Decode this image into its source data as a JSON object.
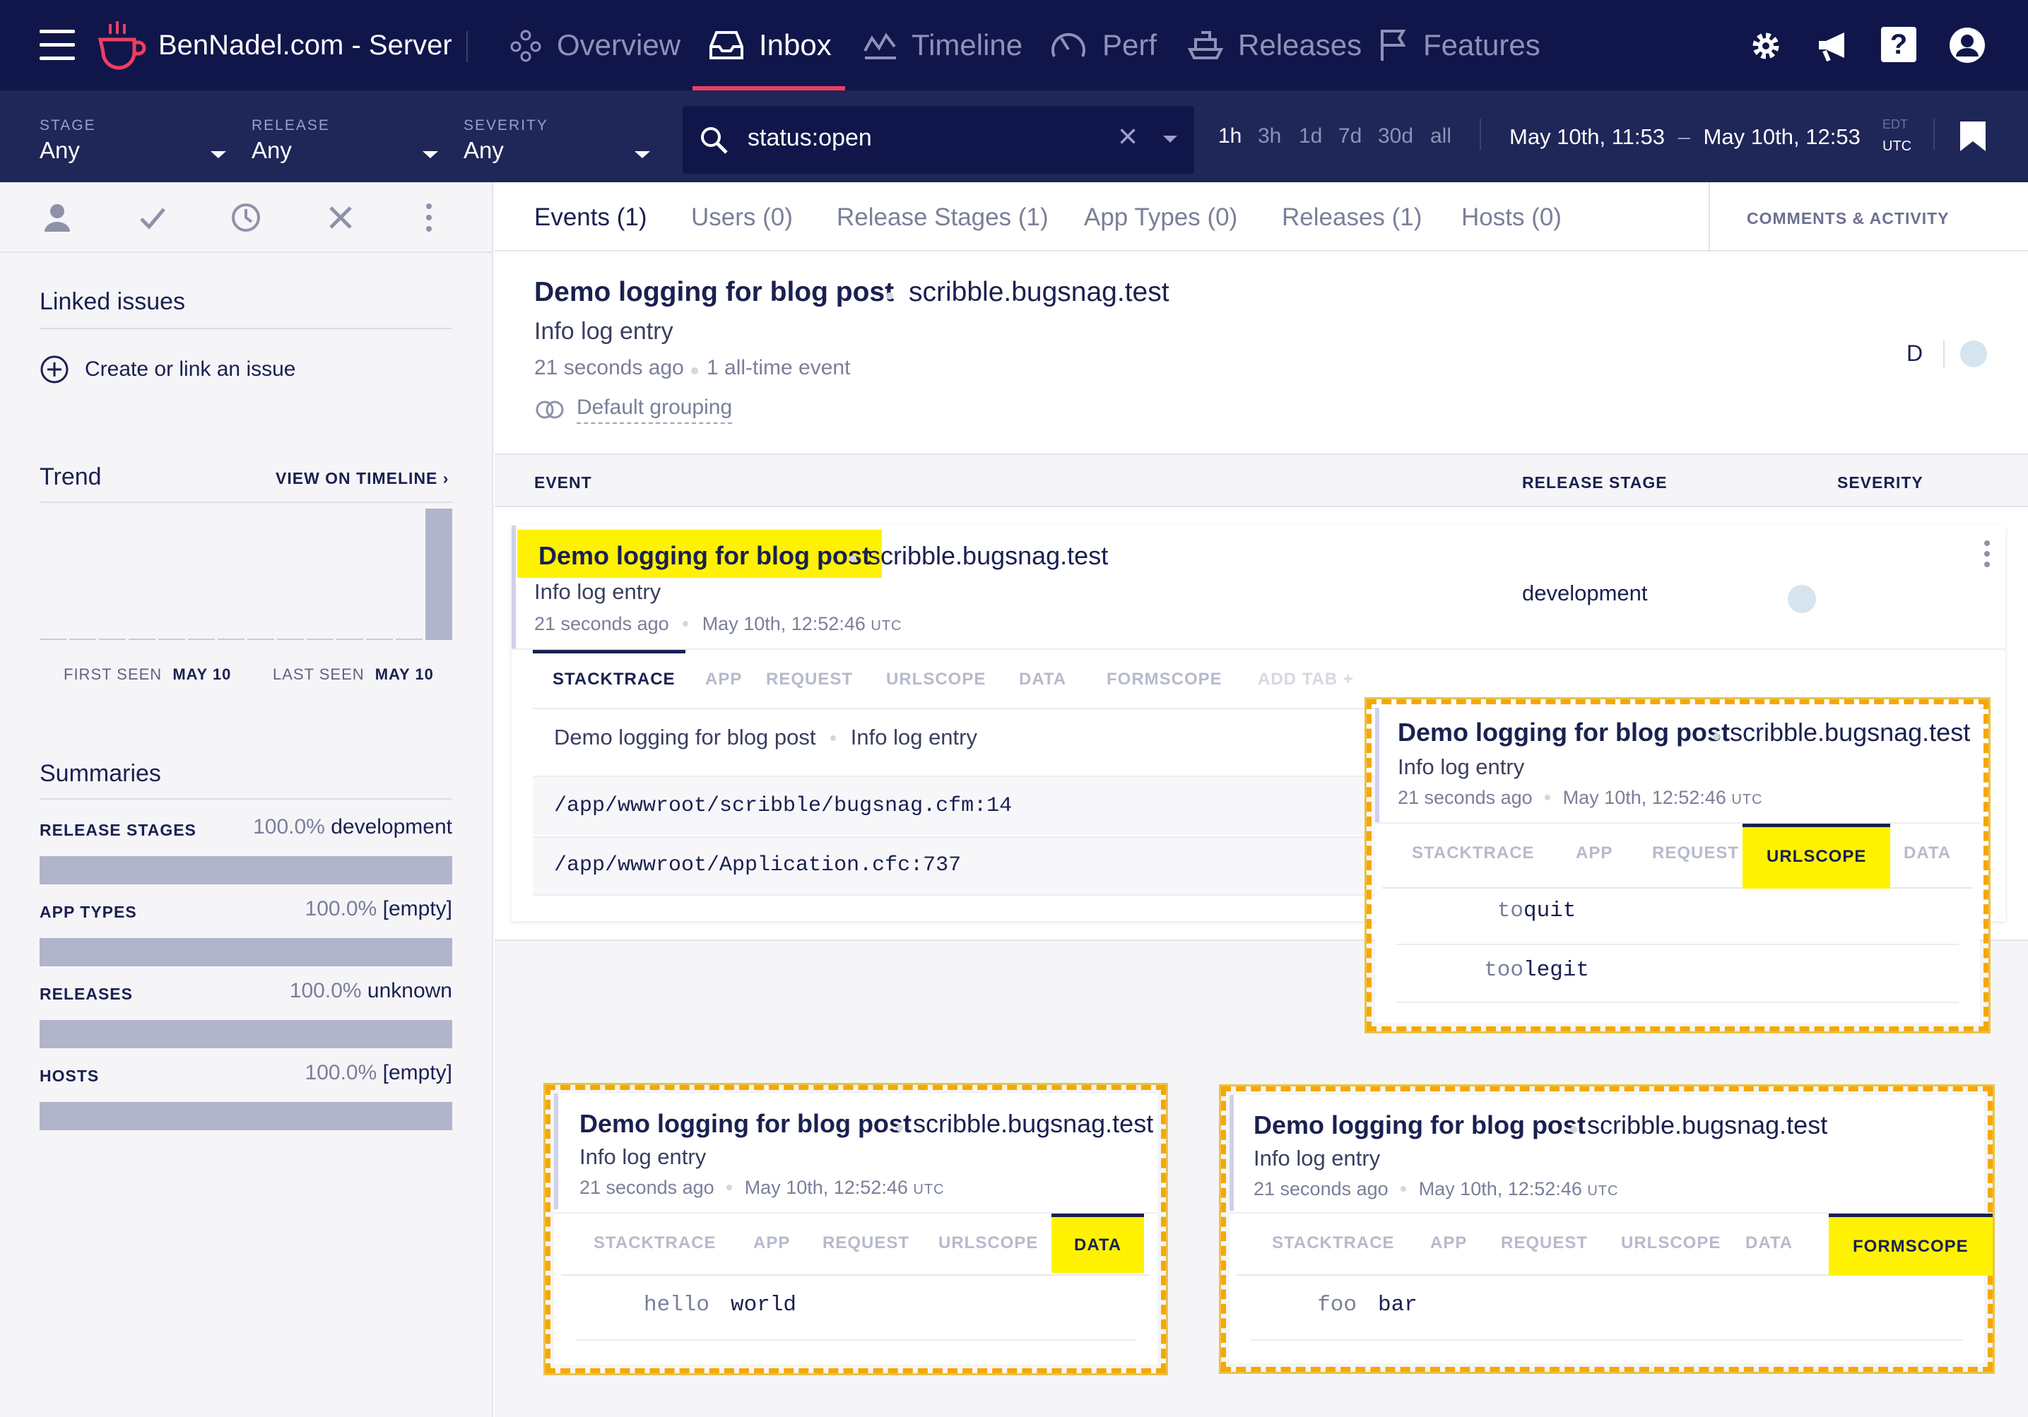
{
  "topnav": {
    "brand": "BenNadel.com - Server",
    "items": [
      {
        "label": "Overview",
        "icon": "overview-icon"
      },
      {
        "label": "Inbox",
        "icon": "inbox-icon",
        "active": true
      },
      {
        "label": "Timeline",
        "icon": "timeline-icon"
      },
      {
        "label": "Perf",
        "icon": "gauge-icon"
      },
      {
        "label": "Releases",
        "icon": "ship-icon"
      },
      {
        "label": "Features",
        "icon": "flag-icon"
      }
    ],
    "right_icons": [
      "gear-icon",
      "megaphone-icon",
      "help-icon",
      "user-icon"
    ],
    "accent_color": "#ef3d63",
    "background_color": "#10164a"
  },
  "filters": {
    "stage": {
      "label": "STAGE",
      "value": "Any"
    },
    "release": {
      "label": "RELEASE",
      "value": "Any"
    },
    "severity": {
      "label": "SEVERITY",
      "value": "Any"
    },
    "search": {
      "query": "status:open"
    },
    "ranges": [
      "1h",
      "3h",
      "1d",
      "7d",
      "30d",
      "all"
    ],
    "selected_range": "1h",
    "date_from": "May 10th, 11:53",
    "date_to": "May 10th, 12:53",
    "date_dash": "–",
    "tz_inactive": "EDT",
    "tz_active": "UTC"
  },
  "sidebar": {
    "actions": [
      "assign-icon",
      "fix-icon",
      "snooze-icon",
      "ignore-icon",
      "more-icon"
    ],
    "linked_issues": {
      "title": "Linked issues",
      "link": "Create or link an issue"
    },
    "trend": {
      "title": "Trend",
      "link": "VIEW ON TIMELINE ›",
      "bar_levels": [
        0,
        0,
        0,
        0,
        0,
        0,
        0,
        0,
        0,
        0,
        0,
        0,
        0,
        1
      ],
      "first_seen_label": "FIRST SEEN",
      "first_seen": "MAY 10",
      "last_seen_label": "LAST SEEN",
      "last_seen": "MAY 10"
    },
    "summaries": {
      "title": "Summaries",
      "rows": [
        {
          "label": "RELEASE STAGES",
          "pct": "100.0%",
          "value": "development",
          "fill": 1.0
        },
        {
          "label": "APP TYPES",
          "pct": "100.0%",
          "value": "[empty]",
          "fill": 1.0
        },
        {
          "label": "RELEASES",
          "pct": "100.0%",
          "value": "unknown",
          "fill": 1.0
        },
        {
          "label": "HOSTS",
          "pct": "100.0%",
          "value": "[empty]",
          "fill": 1.0
        }
      ]
    }
  },
  "main": {
    "tabs": [
      "Events (1)",
      "Users (0)",
      "Release Stages (1)",
      "App Types (0)",
      "Releases (1)",
      "Hosts (0)"
    ],
    "active_tab": "Events (1)",
    "comments_label": "COMMENTS & ACTIVITY",
    "error": {
      "title": "Demo logging for blog post",
      "context": "scribble.bugsnag.test",
      "message": "Info log entry",
      "age": "21 seconds ago",
      "count": "1 all-time event",
      "grouping": "Default grouping",
      "assignee": "D"
    },
    "list_headers": {
      "event": "EVENT",
      "release_stage": "RELEASE STAGE",
      "severity": "SEVERITY"
    },
    "event": {
      "title": "Demo logging for blog post",
      "context": "scribble.bugsnag.test",
      "message": "Info log entry",
      "age": "21 seconds ago",
      "timestamp": "May 10th, 12:52:46",
      "tz": "UTC",
      "release_stage": "development",
      "tabs": [
        "STACKTRACE",
        "APP",
        "REQUEST",
        "URLSCOPE",
        "DATA",
        "FORMSCOPE",
        "ADD TAB +"
      ],
      "active_tab": "STACKTRACE",
      "stack_header_title": "Demo logging for blog post",
      "stack_header_msg": "Info log entry",
      "frames": [
        "/app/wwwroot/scribble/bugsnag.cfm:14",
        "/app/wwwroot/Application.cfc:737"
      ]
    }
  },
  "callouts": {
    "highlight_color": "#fff200",
    "urlscope": {
      "tabs": [
        "STACKTRACE",
        "APP",
        "REQUEST",
        "URLSCOPE",
        "DATA"
      ],
      "active_tab": "URLSCOPE",
      "rows": [
        {
          "key": "to",
          "value": "quit"
        },
        {
          "key": "too",
          "value": "legit"
        }
      ]
    },
    "data": {
      "tabs": [
        "STACKTRACE",
        "APP",
        "REQUEST",
        "URLSCOPE",
        "DATA"
      ],
      "active_tab": "DATA",
      "rows": [
        {
          "key": "hello",
          "value": "world"
        }
      ]
    },
    "formscope": {
      "tabs": [
        "STACKTRACE",
        "APP",
        "REQUEST",
        "URLSCOPE",
        "DATA",
        "FORMSCOPE"
      ],
      "active_tab": "FORMSCOPE",
      "rows": [
        {
          "key": "foo",
          "value": "bar"
        }
      ]
    }
  }
}
